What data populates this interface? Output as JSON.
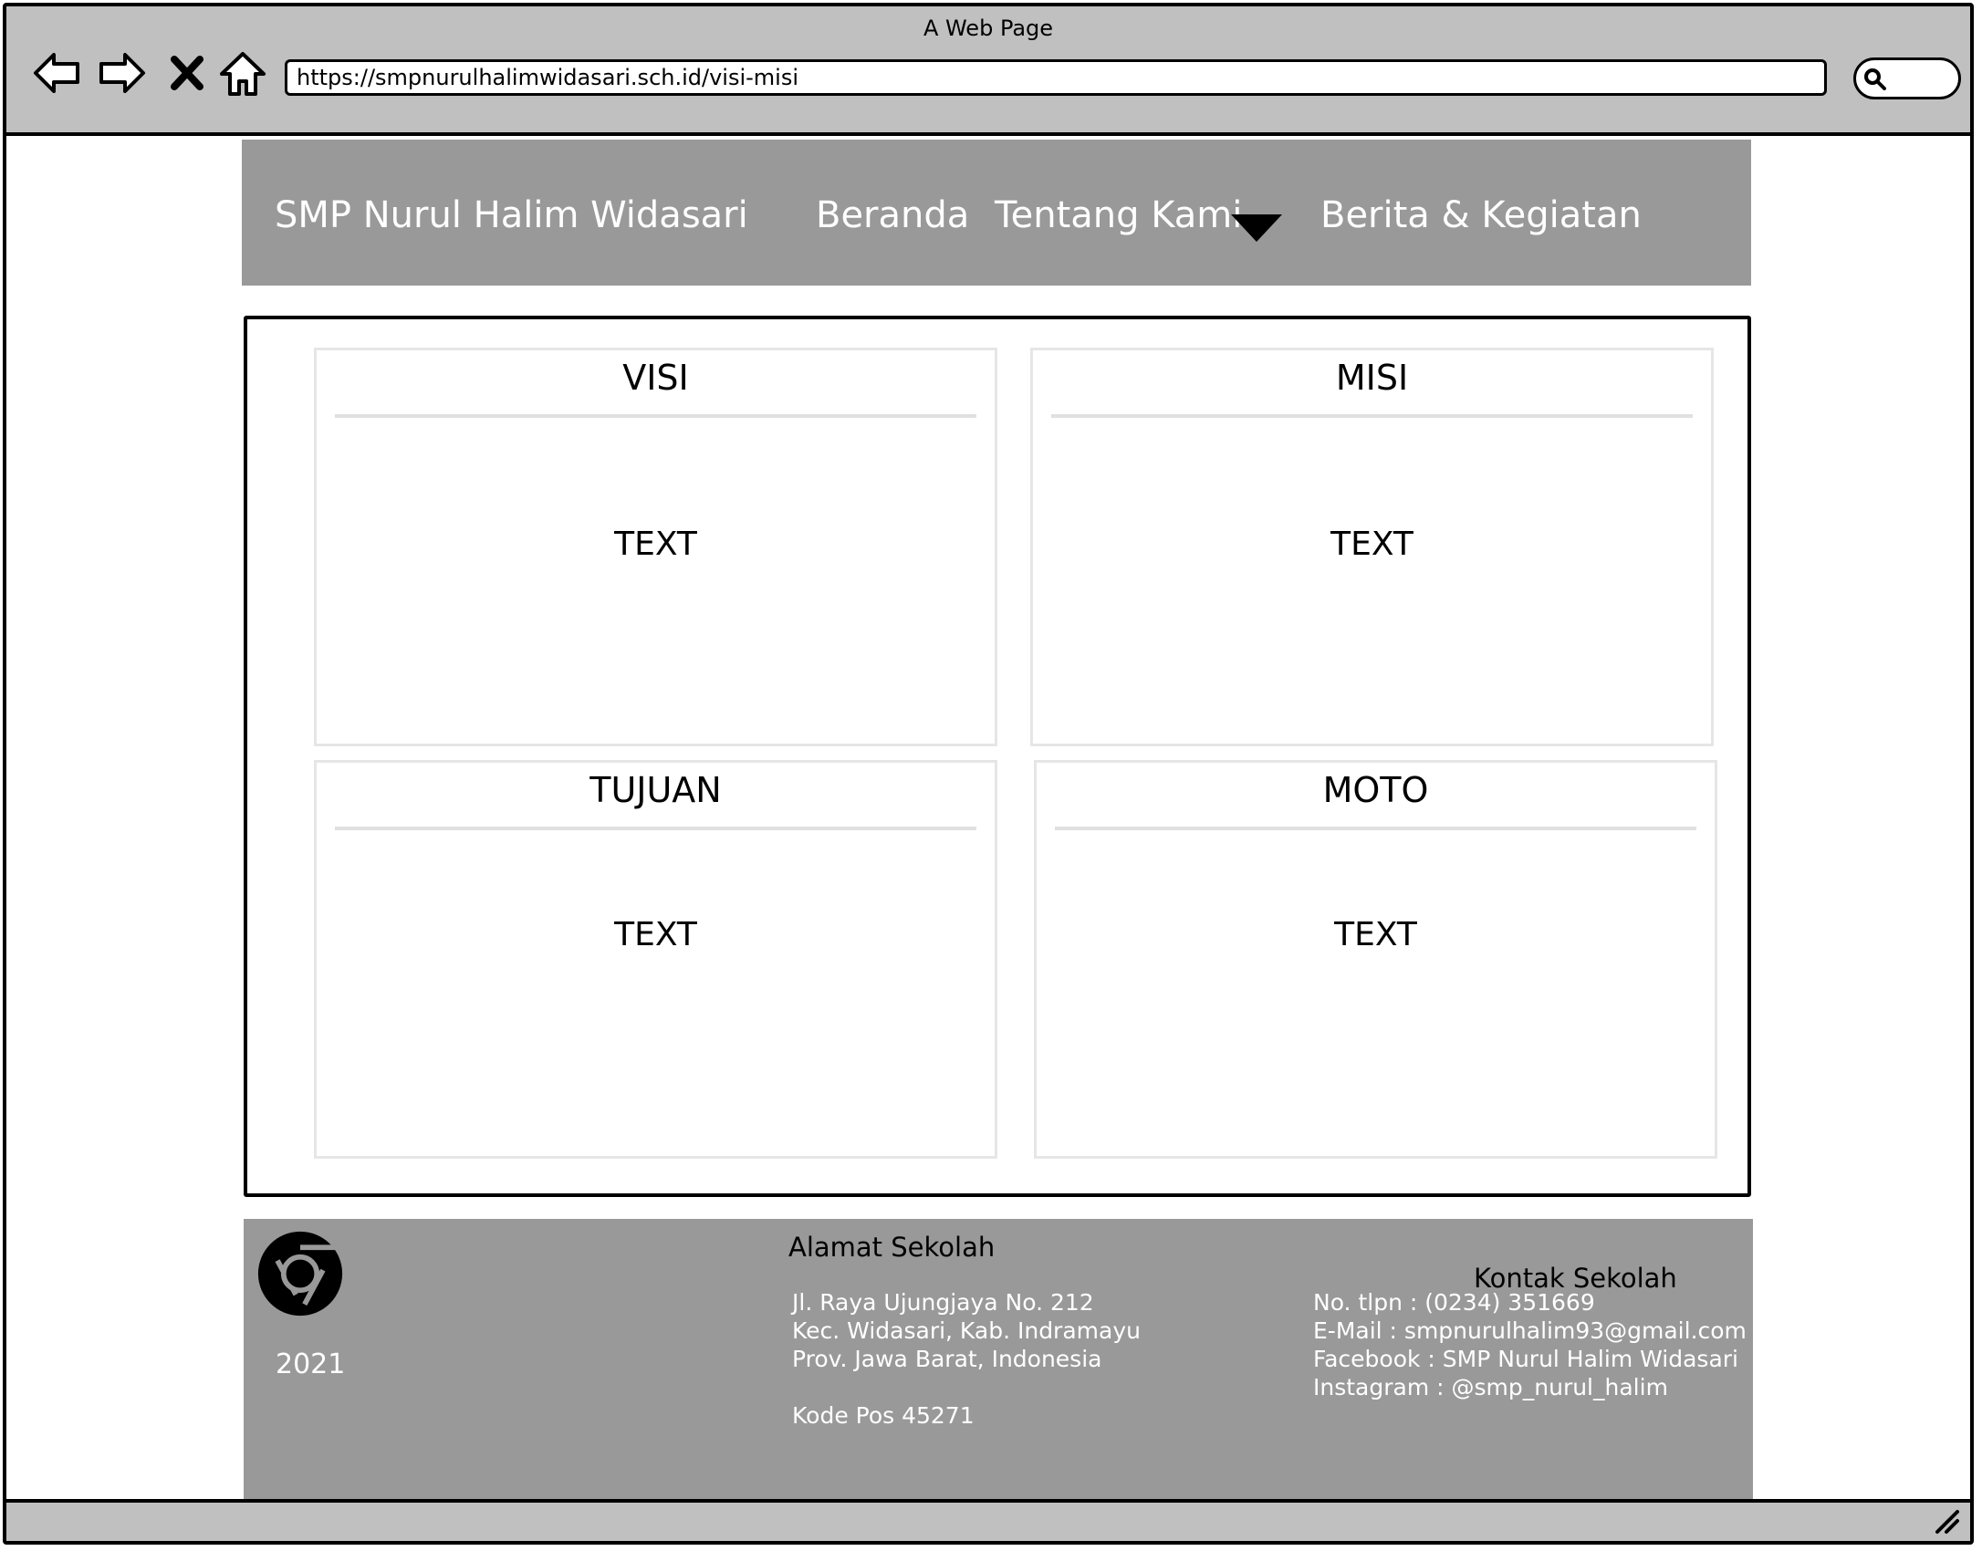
{
  "window": {
    "title": "A Web Page"
  },
  "browser": {
    "url": "https://smpnurulhalimwidasari.sch.id/visi-misi",
    "icons": [
      "back-arrow-icon",
      "forward-arrow-icon",
      "close-x-icon",
      "home-icon",
      "search-icon"
    ]
  },
  "nav": {
    "brand": "SMP Nurul Halim Widasari",
    "home": "Beranda",
    "about": "Tentang Kami",
    "news": "Berita & Kegiatan"
  },
  "cards": [
    {
      "title": "VISI",
      "text": "TEXT"
    },
    {
      "title": "MISI",
      "text": "TEXT"
    },
    {
      "title": "TUJUAN",
      "text": "TEXT"
    },
    {
      "title": "MOTO",
      "text": "TEXT"
    }
  ],
  "footer": {
    "year": "2021",
    "address": {
      "heading": "Alamat Sekolah",
      "lines": [
        "Jl. Raya Ujungjaya No. 212",
        "Kec. Widasari, Kab. Indramayu",
        "Prov. Jawa Barat, Indonesia",
        "",
        "Kode Pos 45271"
      ]
    },
    "contact": {
      "heading": "Kontak Sekolah",
      "lines": [
        "No. tlpn : (0234) 351669",
        "E-Mail : smpnurulhalim93@gmail.com",
        "Facebook : SMP Nurul Halim Widasari",
        "Instagram : @smp_nurul_halim"
      ]
    }
  },
  "colors": {
    "chrome": "#c0c0c0",
    "nav_bg": "#999999",
    "footer_bg": "#999999",
    "card_border": "#e6e6e6"
  }
}
